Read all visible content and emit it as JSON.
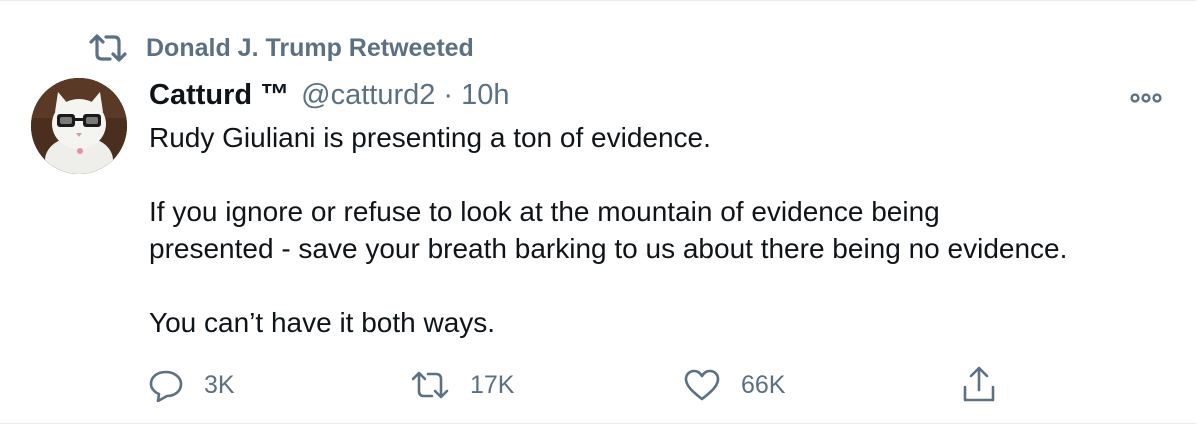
{
  "retweet_context": {
    "label": "Donald J. Trump Retweeted",
    "icon": "retweet-icon"
  },
  "tweet": {
    "display_name": "Catturd ™",
    "handle": "@catturd2",
    "separator": "·",
    "timestamp": "10h",
    "more_icon": "more-icon",
    "lines": {
      "l1": "Rudy Giuliani is presenting a ton of evidence.",
      "l2": "If you ignore or refuse to look at the mountain of evidence being",
      "l3": "presented - save your breath barking to us about there being no evidence.",
      "l4": "You can’t have it both ways."
    }
  },
  "actions": {
    "reply": {
      "icon": "reply-icon",
      "count": "3K"
    },
    "retweet": {
      "icon": "retweet-icon",
      "count": "17K"
    },
    "like": {
      "icon": "heart-icon",
      "count": "66K"
    },
    "share": {
      "icon": "share-icon"
    }
  },
  "colors": {
    "text": "#0f1419",
    "secondary": "#5b7083",
    "border": "#e6ecf0"
  }
}
